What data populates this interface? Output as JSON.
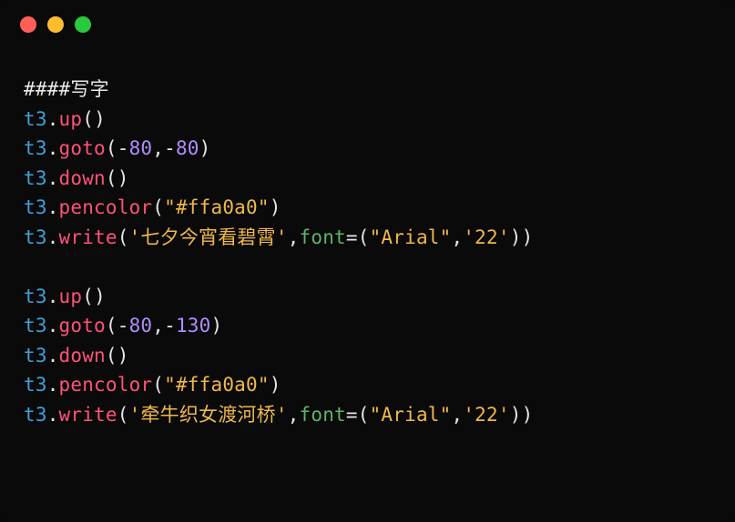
{
  "window": {
    "traffic": {
      "red": "close",
      "yellow": "minimize",
      "green": "zoom"
    }
  },
  "code": {
    "comment1": "####写字",
    "obj": "t3",
    "dot": ".",
    "lp": "(",
    "rp": ")",
    "comma": ",",
    "eq": "=",
    "minus": "-",
    "m_up": "up",
    "m_goto": "goto",
    "m_down": "down",
    "m_pencolor": "pencolor",
    "m_write": "write",
    "kw_font": "font",
    "n80": "80",
    "n130": "130",
    "s_color": "\"#ffa0a0\"",
    "s_text1": "'七夕今宵看碧霄'",
    "s_text2": "'牵牛织女渡河桥'",
    "s_arial": "\"Arial\"",
    "s_22": "'22'"
  }
}
